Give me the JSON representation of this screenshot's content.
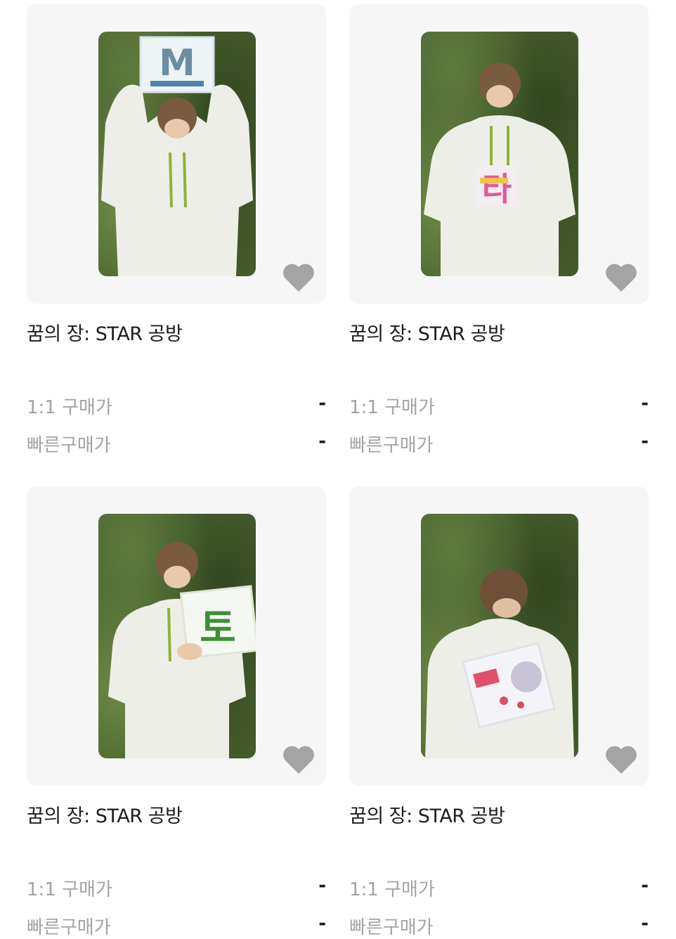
{
  "products": [
    {
      "title": "꿈의 장: STAR 공방",
      "price_1to1_label": "1:1 구매가",
      "price_1to1_value": "-",
      "quick_price_label": "빠른구매가",
      "quick_price_value": "-",
      "sign_glyph": "M"
    },
    {
      "title": "꿈의 장: STAR 공방",
      "price_1to1_label": "1:1 구매가",
      "price_1to1_value": "-",
      "quick_price_label": "빠른구매가",
      "quick_price_value": "-",
      "sign_glyph": "타"
    },
    {
      "title": "꿈의 장: STAR 공방",
      "price_1to1_label": "1:1 구매가",
      "price_1to1_value": "-",
      "quick_price_label": "빠른구매가",
      "quick_price_value": "-",
      "sign_glyph": "토"
    },
    {
      "title": "꿈의 장: STAR 공방",
      "price_1to1_label": "1:1 구매가",
      "price_1to1_value": "-",
      "quick_price_label": "빠른구매가",
      "quick_price_value": "-",
      "sign_glyph": ""
    }
  ],
  "icons": {
    "favorite": "heart-icon"
  },
  "colors": {
    "heart": "#a4a4a4",
    "label": "#a3a3a3",
    "text": "#1c1c1c",
    "thumb_bg": "#f6f6f6"
  }
}
